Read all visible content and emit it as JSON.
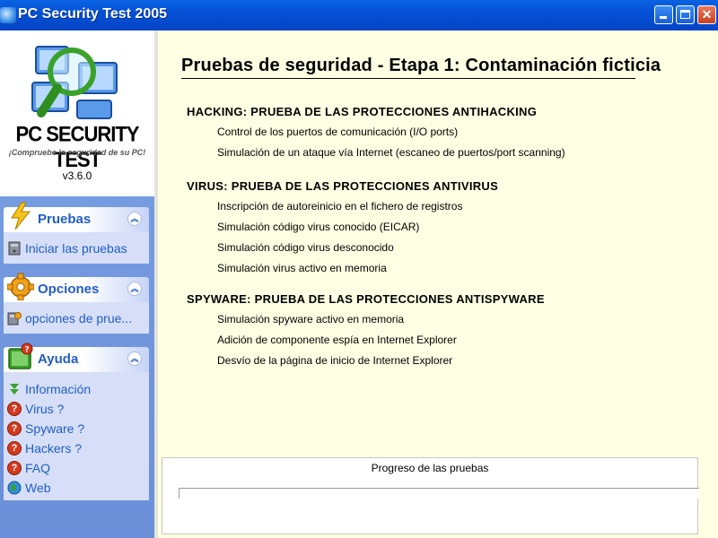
{
  "window": {
    "title": "PC Security Test 2005"
  },
  "logo": {
    "name": "PC SECURITY TEST",
    "slogan": "¡Compruebe la seguridad de su PC!",
    "version": "v3.6.0"
  },
  "sidebar": {
    "panels": [
      {
        "label": "Pruebas",
        "items": [
          {
            "label": "Iniciar las pruebas",
            "icon": "pc-icon"
          }
        ]
      },
      {
        "label": "Opciones",
        "items": [
          {
            "label": "opciones de prue...",
            "icon": "options-pc-icon"
          }
        ]
      },
      {
        "label": "Ayuda",
        "items": [
          {
            "label": "Información",
            "icon": "green-arrow-icon"
          },
          {
            "label": "Virus ?",
            "icon": "help-icon"
          },
          {
            "label": "Spyware ?",
            "icon": "help-icon"
          },
          {
            "label": "Hackers ?",
            "icon": "help-icon"
          },
          {
            "label": "FAQ",
            "icon": "help-icon"
          },
          {
            "label": "Web",
            "icon": "globe-icon"
          }
        ]
      }
    ]
  },
  "main": {
    "title": "Pruebas de seguridad - Etapa 1: Contaminación ficticia",
    "sections": [
      {
        "heading": "HACKING: PRUEBA DE LAS PROTECCIONES ANTIHACKING",
        "items": [
          "Control de los puertos de comunicación (I/O ports)",
          "Simulación de un ataque vía Internet (escaneo de puertos/port scanning)"
        ]
      },
      {
        "heading": "VIRUS: PRUEBA DE LAS PROTECCIONES ANTIVIRUS",
        "items": [
          "Inscripción de autoreinicio en el fichero de registros",
          "Simulación código virus conocido (EICAR)",
          "Simulación código virus desconocido",
          "Simulación virus activo en memoria"
        ]
      },
      {
        "heading": "SPYWARE: PRUEBA DE LAS PROTECCIONES ANTISPYWARE",
        "items": [
          "Simulación spyware activo en memoria",
          "Adición de componente espía en Internet Explorer",
          "Desvío de la página de inicio de Internet Explorer"
        ]
      }
    ],
    "progress": {
      "label": "Progreso de las pruebas",
      "value": 0
    }
  },
  "colors": {
    "titlebar": "#0551d6",
    "sidebar": "#7aa1e6",
    "panel_text": "#215dc6",
    "main_background": "#ffffe3"
  }
}
